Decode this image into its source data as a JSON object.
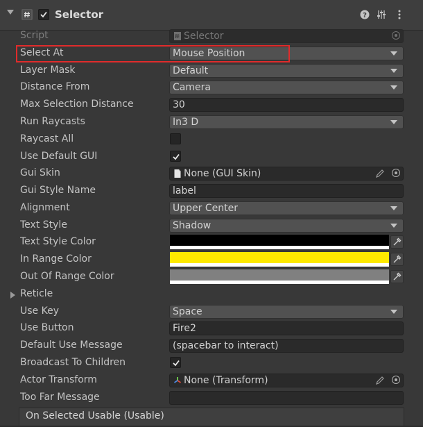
{
  "component": {
    "title": "Selector",
    "enabled": true
  },
  "highlight_color": "#e02b2b",
  "fields": {
    "script": {
      "label": "Script",
      "value": "Selector"
    },
    "select_at": {
      "label": "Select At",
      "value": "Mouse Position"
    },
    "layer_mask": {
      "label": "Layer Mask",
      "value": "Default"
    },
    "distance_from": {
      "label": "Distance From",
      "value": "Camera"
    },
    "max_selection_distance": {
      "label": "Max Selection Distance",
      "value": "30"
    },
    "run_raycasts": {
      "label": "Run Raycasts",
      "value": "In3 D"
    },
    "raycast_all": {
      "label": "Raycast All",
      "checked": false
    },
    "use_default_gui": {
      "label": "Use Default GUI",
      "checked": true
    },
    "gui_skin": {
      "label": "Gui Skin",
      "value": "None (GUI Skin)"
    },
    "gui_style_name": {
      "label": "Gui Style Name",
      "value": "label"
    },
    "alignment": {
      "label": "Alignment",
      "value": "Upper Center"
    },
    "text_style": {
      "label": "Text Style",
      "value": "Shadow"
    },
    "text_style_color": {
      "label": "Text Style Color",
      "color": "#000000"
    },
    "in_range_color": {
      "label": "In Range Color",
      "color": "#ffea00"
    },
    "out_of_range_color": {
      "label": "Out Of Range Color",
      "color": "#808080"
    },
    "reticle": {
      "label": "Reticle"
    },
    "use_key": {
      "label": "Use Key",
      "value": "Space"
    },
    "use_button": {
      "label": "Use Button",
      "value": "Fire2"
    },
    "default_use_message": {
      "label": "Default Use Message",
      "value": "(spacebar to interact)"
    },
    "broadcast_to_children": {
      "label": "Broadcast To Children",
      "checked": true
    },
    "actor_transform": {
      "label": "Actor Transform",
      "value": "None (Transform)"
    },
    "too_far_message": {
      "label": "Too Far Message",
      "value": ""
    }
  },
  "event": {
    "label": "On Selected Usable (Usable)"
  },
  "icons": [
    "script-hash-icon",
    "help-icon",
    "preset-icon",
    "kebab-menu-icon",
    "object-picker-icon",
    "pencil-icon",
    "eyedropper-icon",
    "transform-icon",
    "file-icon",
    "checkmark-icon"
  ]
}
